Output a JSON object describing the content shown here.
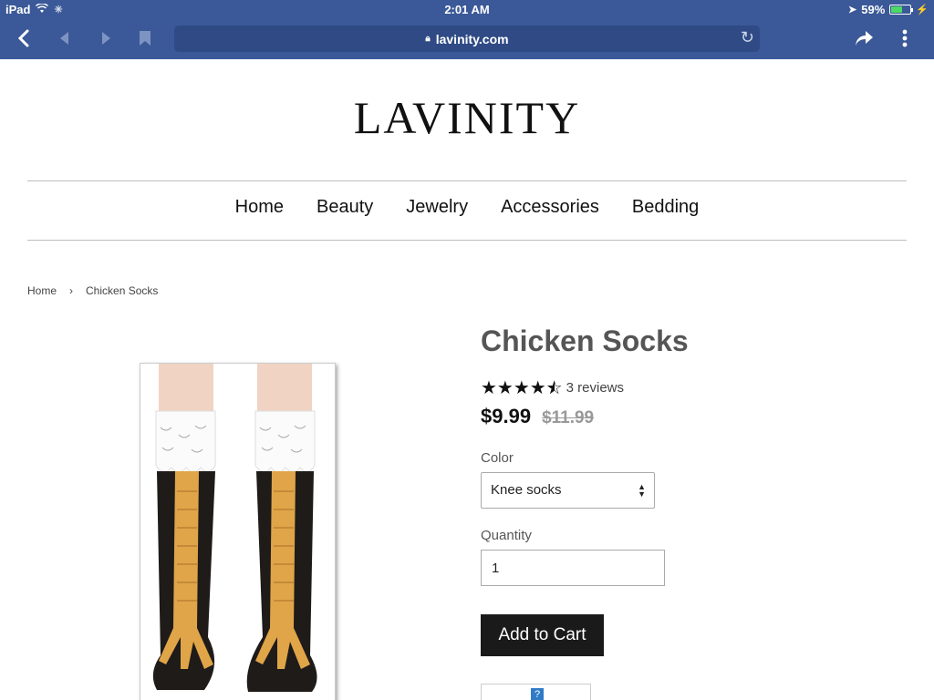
{
  "status": {
    "device": "iPad",
    "time": "2:01 AM",
    "battery": "59%",
    "battery_level": 0.59
  },
  "browser": {
    "url": "lavinity.com"
  },
  "store": {
    "logo": "LAVINITY",
    "nav": [
      "Home",
      "Beauty",
      "Jewelry",
      "Accessories",
      "Bedding"
    ]
  },
  "breadcrumb": {
    "home": "Home",
    "separator": "›",
    "current": "Chicken Socks"
  },
  "product": {
    "title": "Chicken Socks",
    "rating": 4.5,
    "reviews": "3 reviews",
    "price": "$9.99",
    "compare_price": "$11.99",
    "color_label": "Color",
    "color_value": "Knee socks",
    "quantity_label": "Quantity",
    "quantity_value": "1",
    "add_to_cart": "Add to Cart"
  },
  "colors": {
    "chrome": "#3b5998",
    "button": "#1a1a1a"
  }
}
